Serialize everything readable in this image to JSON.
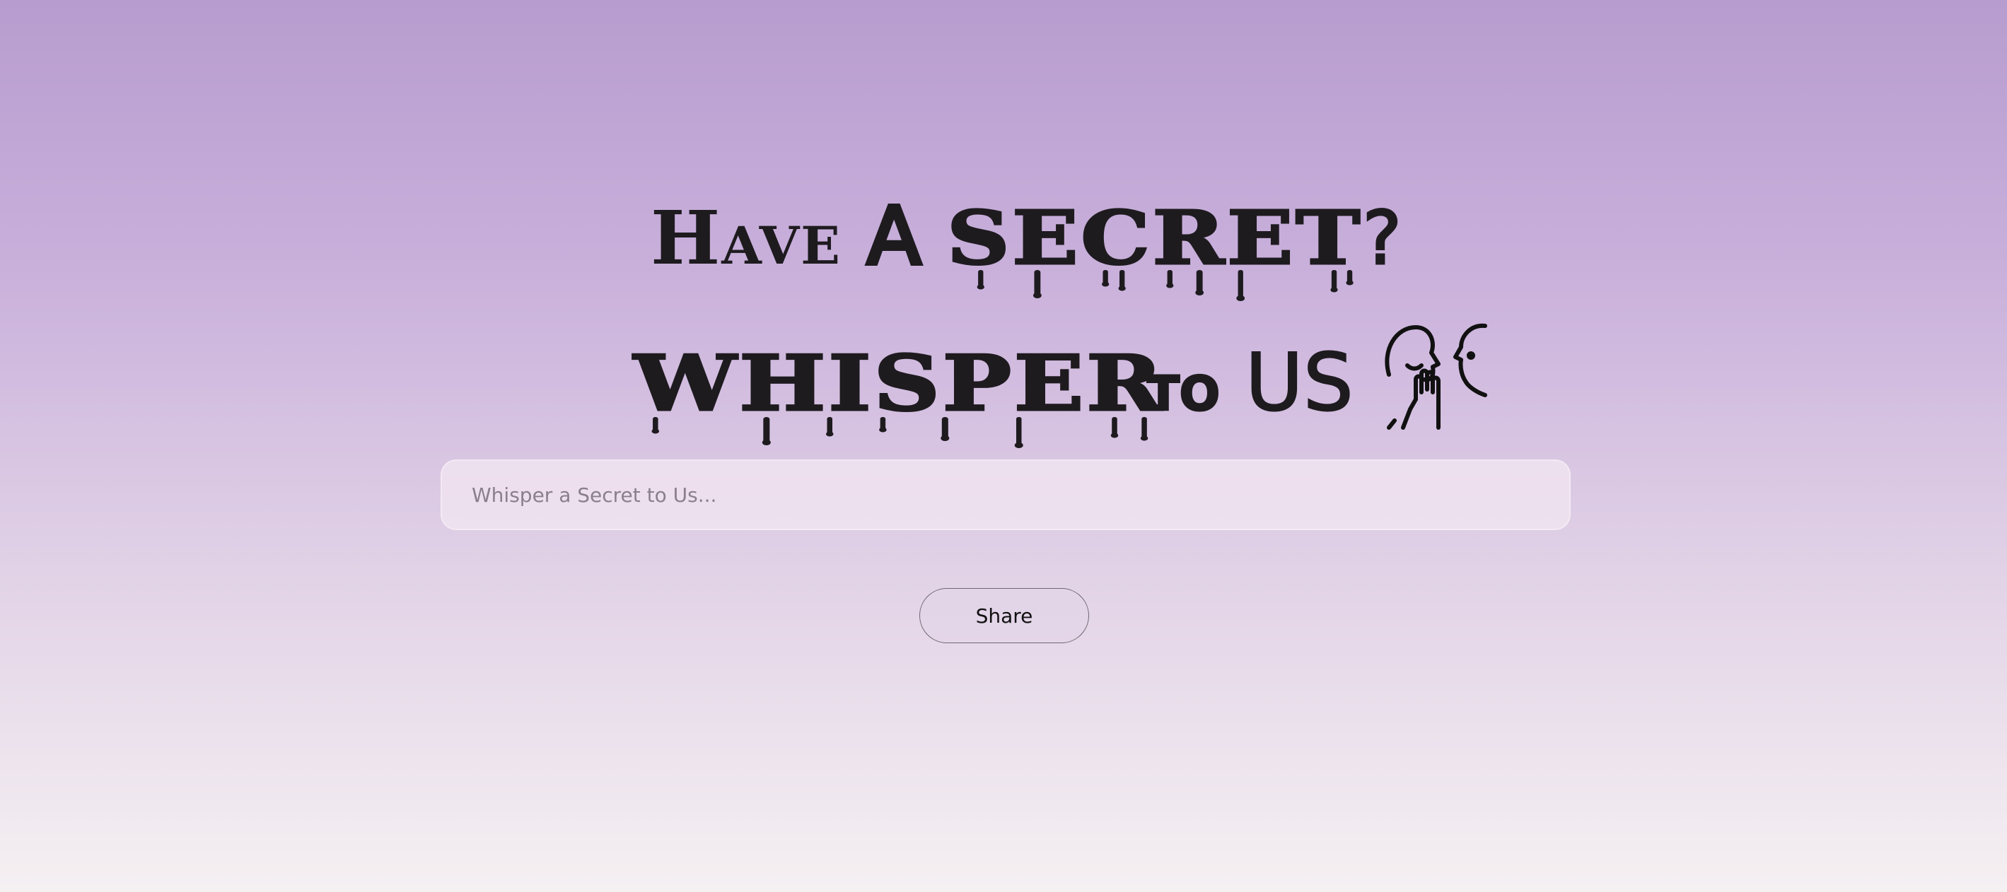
{
  "headline": {
    "line1": {
      "have": "Have",
      "a": "A",
      "secret": "secret",
      "question": "?"
    },
    "line2": {
      "whisper": "whisper",
      "to": "to",
      "us": "US"
    },
    "icon": "whisper-icon"
  },
  "form": {
    "input_placeholder": "Whisper a Secret to Us...",
    "input_value": "",
    "share_label": "Share"
  },
  "colors": {
    "gradient_top": "#b79ccf",
    "gradient_bottom": "#f5f0f2",
    "text": "#1e1b1f"
  }
}
